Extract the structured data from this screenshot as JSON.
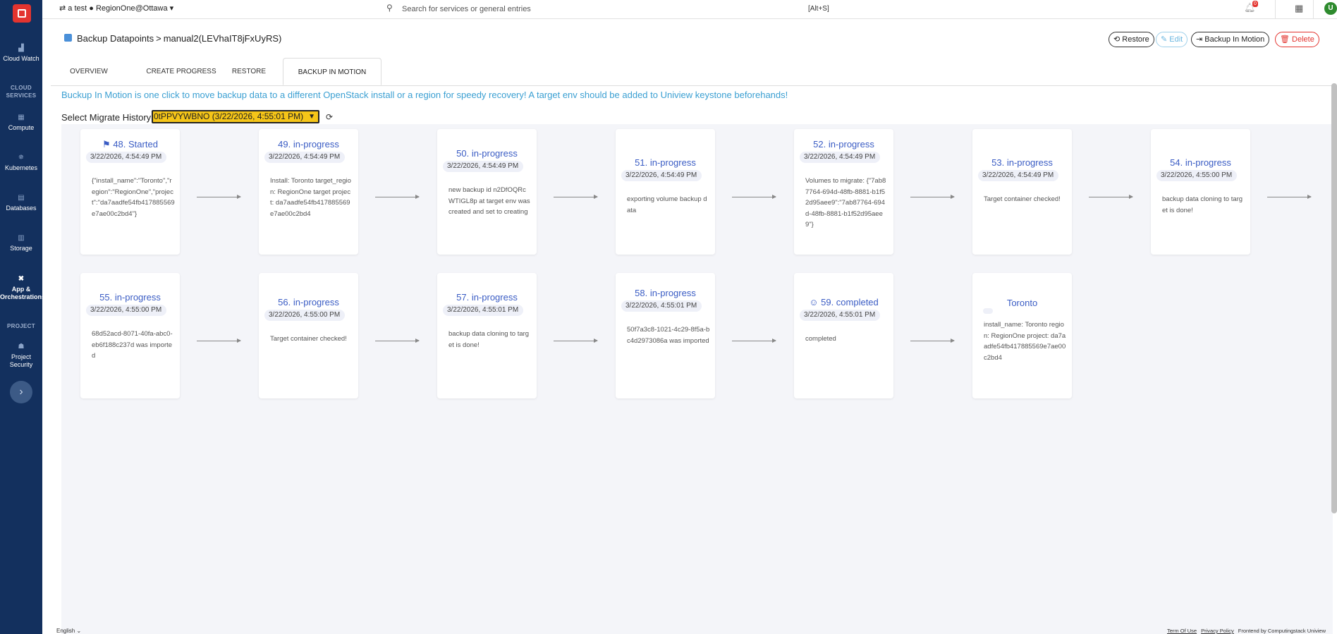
{
  "topbar": {
    "project": "a test ● RegionOne@Ottawa",
    "search_placeholder": "Search for services or general entries",
    "shortcut": "[Alt+S]",
    "notification_count": "0",
    "avatar_letter": "U"
  },
  "sidebar": {
    "items": [
      {
        "label": "Cloud Watch"
      },
      {
        "label": "Compute"
      },
      {
        "label": "Kubernetes"
      },
      {
        "label": "Databases"
      },
      {
        "label": "Storage"
      },
      {
        "label": "App & Orchestrations"
      },
      {
        "label": "Project Security"
      }
    ],
    "headings": {
      "cloud_services": "CLOUD SERVICES",
      "project": "PROJECT"
    }
  },
  "header": {
    "breadcrumb_parent": "Backup Datapoints",
    "breadcrumb_sep": ">",
    "breadcrumb_current": "manual2(LEVhaIT8jFxUyRS)",
    "buttons": {
      "restore": "Restore",
      "edit": "Edit",
      "backup_in_motion": "Backup In Motion",
      "delete": "Delete"
    }
  },
  "tabs": [
    "OVERVIEW",
    "CREATE PROGRESS",
    "RESTORE",
    "BACKUP IN MOTION"
  ],
  "info_text": "Buckup In Motion is one click to move backup data to a different OpenStack install or a region for speedy recovery! A target env should be added to Uniview keystone beforehands!",
  "migrate": {
    "label": "Select Migrate History:",
    "selected": "0tPPVYWBNO (3/22/2026, 4:55:01 PM)"
  },
  "steps": [
    {
      "title": "48. Started",
      "time": "3/22/2026, 4:54:49 PM",
      "desc": "{\"install_name\":\"Toronto\",\"region\":\"RegionOne\",\"project\":\"da7aadfe54fb417885569e7ae00c2bd4\"}",
      "icon": "flag-icon"
    },
    {
      "title": "49. in-progress",
      "time": "3/22/2026, 4:54:49 PM",
      "desc": "Install: Toronto target_region: RegionOne target project: da7aadfe54fb417885569e7ae00c2bd4"
    },
    {
      "title": "50. in-progress",
      "time": "3/22/2026, 4:54:49 PM",
      "desc": "new backup id n2DfOQRcWTIGL8p at target env was created and set to creating"
    },
    {
      "title": "51. in-progress",
      "time": "3/22/2026, 4:54:49 PM",
      "desc": "exporting volume backup data"
    },
    {
      "title": "52. in-progress",
      "time": "3/22/2026, 4:54:49 PM",
      "desc": "Volumes to migrate: {\"7ab87764-694d-48fb-8881-b1f52d95aee9\":\"7ab87764-694d-48fb-8881-b1f52d95aee9\"}"
    },
    {
      "title": "53. in-progress",
      "time": "3/22/2026, 4:54:49 PM",
      "desc": "Target container checked!"
    },
    {
      "title": "54. in-progress",
      "time": "3/22/2026, 4:55:00 PM",
      "desc": "backup data cloning to target is done!"
    },
    {
      "title": "55. in-progress",
      "time": "3/22/2026, 4:55:00 PM",
      "desc": "68d52acd-8071-40fa-abc0-eb6f188c237d was imported"
    },
    {
      "title": "56. in-progress",
      "time": "3/22/2026, 4:55:00 PM",
      "desc": "Target container checked!"
    },
    {
      "title": "57. in-progress",
      "time": "3/22/2026, 4:55:01 PM",
      "desc": "backup data cloning to target is done!"
    },
    {
      "title": "58. in-progress",
      "time": "3/22/2026, 4:55:01 PM",
      "desc": "50f7a3c8-1021-4c29-8f5a-bc4d2973086a was imported"
    },
    {
      "title": "59. completed",
      "time": "3/22/2026, 4:55:01 PM",
      "desc": "completed",
      "icon": "smile-icon"
    },
    {
      "title": "Toronto",
      "time": "",
      "desc": "install_name: Toronto region: RegionOne project: da7aadfe54fb417885569e7ae00c2bd4"
    }
  ],
  "footer": {
    "language": "English",
    "terms": "Term Of Use",
    "privacy": "Privacy Policy",
    "credit": "Frontend by Computingstack Uniview"
  }
}
